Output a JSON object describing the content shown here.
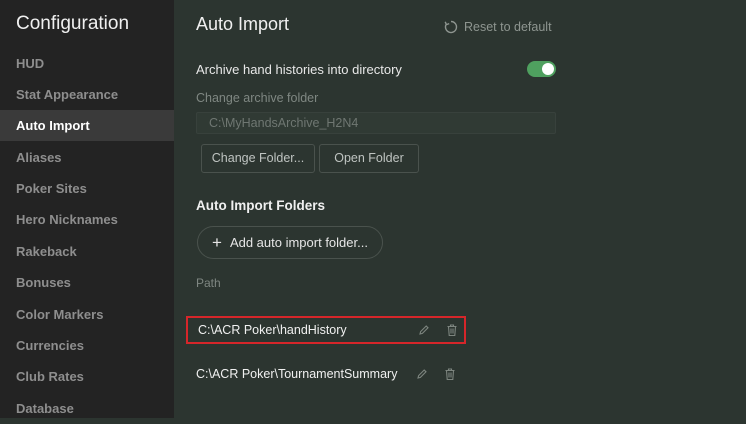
{
  "sidebar": {
    "title": "Configuration",
    "items": [
      {
        "label": "HUD"
      },
      {
        "label": "Stat Appearance"
      },
      {
        "label": "Auto Import"
      },
      {
        "label": "Aliases"
      },
      {
        "label": "Poker Sites"
      },
      {
        "label": "Hero Nicknames"
      },
      {
        "label": "Rakeback"
      },
      {
        "label": "Bonuses"
      },
      {
        "label": "Color Markers"
      },
      {
        "label": "Currencies"
      },
      {
        "label": "Club Rates"
      },
      {
        "label": "Database"
      }
    ],
    "active_item": "Auto Import"
  },
  "header": {
    "title": "Auto Import",
    "reset_label": "Reset to default",
    "reset_icon": "reset-icon"
  },
  "archive": {
    "label": "Archive hand histories into directory",
    "toggle_on": true,
    "change_label": "Change archive folder",
    "folder_value": "C:\\MyHandsArchive_H2N4",
    "change_button": "Change Folder...",
    "open_button": "Open Folder"
  },
  "folders": {
    "section_title": "Auto Import Folders",
    "add_button": "Add auto import folder...",
    "column_header": "Path",
    "rows": [
      {
        "path": "C:\\ACR Poker\\handHistory",
        "highlighted": true
      },
      {
        "path": "C:\\ACR Poker\\TournamentSummary",
        "highlighted": false
      }
    ]
  },
  "colors": {
    "accent_toggle": "#4fa05f",
    "highlight_border": "#d6262a",
    "sidebar_bg": "#232323",
    "main_bg": "#2c3530"
  }
}
